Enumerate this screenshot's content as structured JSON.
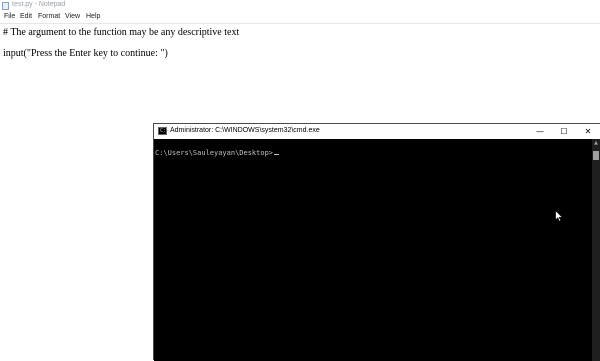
{
  "notepad": {
    "window_title": "test.py - Notepad",
    "menu": [
      "File",
      "Edit",
      "Format",
      "View",
      "Help"
    ],
    "lines": [
      "# The argument to the function may be any descriptive text",
      "input(\"Press the Enter key to continue: \")"
    ]
  },
  "cmd": {
    "window_title": "Administrator: C:\\WINDOWS\\system32\\cmd.exe",
    "icon_glyph": "C:\\",
    "controls": {
      "minimize": "—",
      "maximize": "☐",
      "close": "✕"
    },
    "prompt": "C:\\Users\\Sauleyayan\\Desktop>"
  },
  "icons": {
    "notepad_icon": "notepad-app-icon",
    "cmd_icon": "cmd-app-icon",
    "pointer": "mouse-pointer-icon"
  },
  "colors": {
    "cmd_background": "#000000",
    "cmd_text": "#c0c0c0",
    "titlebar_background": "#ffffff"
  }
}
